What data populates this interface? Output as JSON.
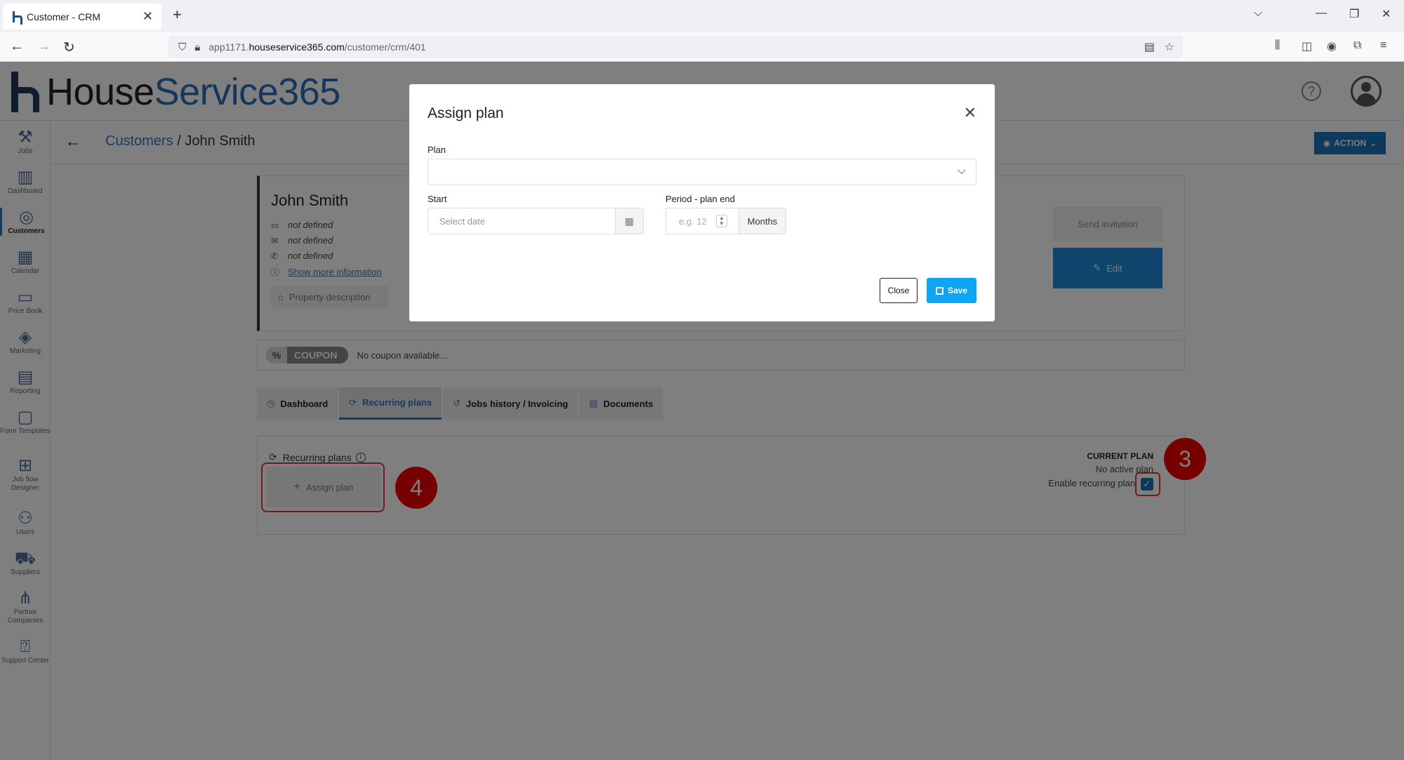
{
  "browser": {
    "tab_title": "Customer - CRM",
    "url_prefix": "app1171.",
    "url_host": "houseservice365.com",
    "url_path": "/customer/crm/401"
  },
  "app": {
    "logo_part1": "House",
    "logo_part2": "Service365",
    "help_glyph": "?"
  },
  "sidebar": {
    "items": [
      {
        "label": "Jobs",
        "icon": "tools-icon"
      },
      {
        "label": "Dashboard",
        "icon": "bar-chart-icon"
      },
      {
        "label": "Customers",
        "icon": "target-icon"
      },
      {
        "label": "Calendar",
        "icon": "calendar-icon"
      },
      {
        "label": "Price Book",
        "icon": "price-tag-icon"
      },
      {
        "label": "Marketing",
        "icon": "tag-icon"
      },
      {
        "label": "Reporting",
        "icon": "report-icon"
      },
      {
        "label": "Form Templates",
        "icon": "form-icon"
      },
      {
        "label": "Job flow Designer",
        "icon": "flow-icon"
      },
      {
        "label": "Users",
        "icon": "users-icon"
      },
      {
        "label": "Suppliers",
        "icon": "truck-icon"
      },
      {
        "label": "Partner Companies",
        "icon": "network-icon"
      },
      {
        "label": "Support Center",
        "icon": "support-icon"
      }
    ]
  },
  "breadcrumb": {
    "link": "Customers",
    "separator": "/",
    "current": "John Smith"
  },
  "action_label": "ACTION",
  "customer": {
    "name": "John Smith",
    "tag": "not defined",
    "email": "not defined",
    "phone": "not defined",
    "more_info": "Show more information",
    "property_description": "Property description",
    "send_invitation": "Send invitation",
    "edit": "Edit"
  },
  "coupon": {
    "badge_symbol": "%",
    "badge_label": "COUPON",
    "text": "No coupon available..."
  },
  "tabs": [
    {
      "label": "Dashboard",
      "icon": "dashboard-icon"
    },
    {
      "label": "Recurring plans",
      "icon": "refresh-icon"
    },
    {
      "label": "Jobs history / Invoicing",
      "icon": "history-icon"
    },
    {
      "label": "Documents",
      "icon": "document-icon"
    }
  ],
  "recurring": {
    "title": "Recurring plans",
    "assign_label": "Assign plan",
    "current_plan_title": "CURRENT PLAN",
    "current_plan_value": "No active plan",
    "enable_label": "Enable recurring plan"
  },
  "annotations": {
    "step_assign": "4",
    "step_enable": "3",
    "color": "#ee0000"
  },
  "modal": {
    "title": "Assign plan",
    "plan_label": "Plan",
    "start_label": "Start",
    "start_placeholder": "Select date",
    "period_label": "Period - plan end",
    "period_placeholder": "e.g. 12",
    "period_unit": "Months",
    "close_label": "Close",
    "save_label": "Save"
  },
  "colors": {
    "brand_blue": "#2b6fb6",
    "save_blue": "#0ea5f2",
    "action_blue": "#1a73b8"
  }
}
